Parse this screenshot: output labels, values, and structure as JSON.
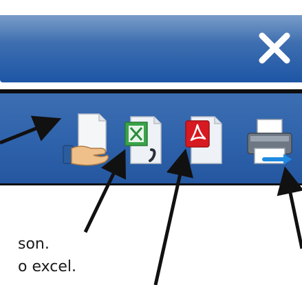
{
  "window": {
    "close_icon": "close-icon"
  },
  "toolbar": {
    "buttons": [
      {
        "icon": "share-document-icon"
      },
      {
        "icon": "excel-export-icon"
      },
      {
        "icon": "pdf-export-icon"
      },
      {
        "icon": "print-icon"
      }
    ]
  },
  "annotations": {
    "line1": "son.",
    "line2": "o excel."
  },
  "colors": {
    "titlebar": "#2f63ab",
    "toolbar": "#2f63ab",
    "close_glyph": "#ffffff",
    "excel_green": "#3aa34a",
    "pdf_red": "#d71921",
    "arrow": "#111111"
  }
}
